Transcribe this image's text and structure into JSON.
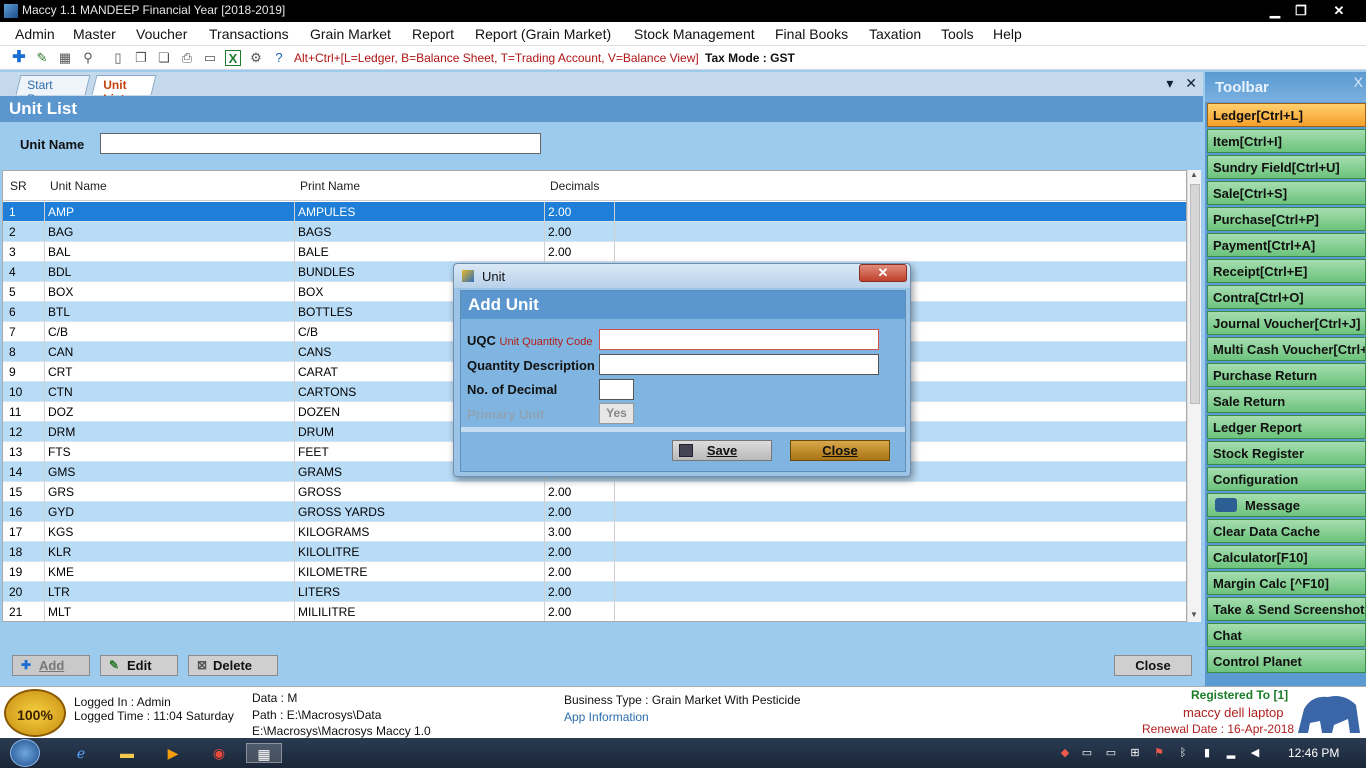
{
  "window": {
    "title": "Maccy 1.1 MANDEEP Financial Year [2018-2019]",
    "minimize": "▁",
    "maximize": "❐",
    "close": "✕"
  },
  "menu": [
    "Admin",
    "Master",
    "Voucher",
    "Transactions",
    "Grain Market",
    "Report",
    "Report (Grain Market)",
    "Stock Management",
    "Final Books",
    "Taxation",
    "Tools",
    "Help"
  ],
  "toolbar": {
    "hint": "Alt+Ctrl+[L=Ledger, B=Balance Sheet, T=Trading Account, V=Balance View]",
    "tax_mode": "Tax Mode : GST",
    "icons": [
      "plus-icon",
      "edit-icon",
      "calculator-icon",
      "filter-icon",
      "new-doc-icon",
      "copy-icon",
      "paste-icon",
      "print-icon",
      "preview-icon",
      "excel-icon",
      "settings-icon",
      "help-icon"
    ]
  },
  "tabs": {
    "start": "Start Page",
    "unit": "Unit List"
  },
  "panel": {
    "heading": "Unit List",
    "unit_name_label": "Unit Name",
    "unit_name_value": ""
  },
  "grid": {
    "columns": [
      "SR",
      "Unit Name",
      "Print Name",
      "Decimals"
    ],
    "rows": [
      [
        "1",
        "AMP",
        "AMPULES",
        "2.00"
      ],
      [
        "2",
        "BAG",
        "BAGS",
        "2.00"
      ],
      [
        "3",
        "BAL",
        "BALE",
        "2.00"
      ],
      [
        "4",
        "BDL",
        "BUNDLES",
        ""
      ],
      [
        "5",
        "BOX",
        "BOX",
        ""
      ],
      [
        "6",
        "BTL",
        "BOTTLES",
        ""
      ],
      [
        "7",
        "C/B",
        "C/B",
        ""
      ],
      [
        "8",
        "CAN",
        "CANS",
        ""
      ],
      [
        "9",
        "CRT",
        "CARAT",
        ""
      ],
      [
        "10",
        "CTN",
        "CARTONS",
        ""
      ],
      [
        "11",
        "DOZ",
        "DOZEN",
        ""
      ],
      [
        "12",
        "DRM",
        "DRUM",
        ""
      ],
      [
        "13",
        "FTS",
        "FEET",
        ""
      ],
      [
        "14",
        "GMS",
        "GRAMS",
        ""
      ],
      [
        "15",
        "GRS",
        "GROSS",
        "2.00"
      ],
      [
        "16",
        "GYD",
        "GROSS YARDS",
        "2.00"
      ],
      [
        "17",
        "KGS",
        "KILOGRAMS",
        "3.00"
      ],
      [
        "18",
        "KLR",
        "KILOLITRE",
        "2.00"
      ],
      [
        "19",
        "KME",
        "KILOMETRE",
        "2.00"
      ],
      [
        "20",
        "LTR",
        "LITERS",
        "2.00"
      ],
      [
        "21",
        "MLT",
        "MILILITRE",
        "2.00"
      ]
    ]
  },
  "buttons": {
    "add": "Add",
    "edit": "Edit",
    "delete": "Delete",
    "close": "Close"
  },
  "sidebar": {
    "title": "Toolbar",
    "close": "X",
    "items": [
      "Ledger[Ctrl+L]",
      "Item[Ctrl+I]",
      "Sundry Field[Ctrl+U]",
      "Sale[Ctrl+S]",
      "Purchase[Ctrl+P]",
      "Payment[Ctrl+A]",
      "Receipt[Ctrl+E]",
      "Contra[Ctrl+O]",
      "Journal Voucher[Ctrl+J]",
      "Multi Cash Voucher[Ctrl+",
      "Purchase Return",
      "Sale Return",
      "Ledger Report",
      "Stock Register",
      "Configuration",
      "Message",
      "Clear Data Cache",
      "Calculator[F10]",
      "Margin Calc [^F10]",
      "Take & Send Screenshot",
      "Chat",
      "Control Planet"
    ]
  },
  "status": {
    "seal": "100%",
    "logged_in": "Logged In : Admin",
    "logged_time": "Logged Time : 11:04 Saturday",
    "data": "Data : M",
    "path": "Path : E:\\Macrosys\\Data",
    "path2": "E:\\Macrosys\\Macrosys Maccy 1.0",
    "business": "Business Type : Grain Market With Pesticide",
    "app_info": "App Information",
    "registered": "Registered To [1]",
    "machine": "maccy dell laptop",
    "renewal": "Renewal Date : 16-Apr-2018"
  },
  "taskbar": {
    "clock": "12:46 PM"
  },
  "dialog": {
    "title": "Unit",
    "close": "✕",
    "heading": "Add Unit",
    "uqc_label": "UQC",
    "uqc_sub": "Unit Quantity Code",
    "qty_desc_label": "Quantity Description",
    "decimal_label": "No. of Decimal",
    "primary_label": "Primary Unit",
    "primary_value": "Yes",
    "save": "Save",
    "close_btn": "Close"
  },
  "colors": {
    "selected_row": "#1e7ed8",
    "alt_row": "#b9dcf6",
    "panel_head": "#5b96cf",
    "sidebar_active": "#f6a02a",
    "sidebar_item": "#6cc37c"
  }
}
